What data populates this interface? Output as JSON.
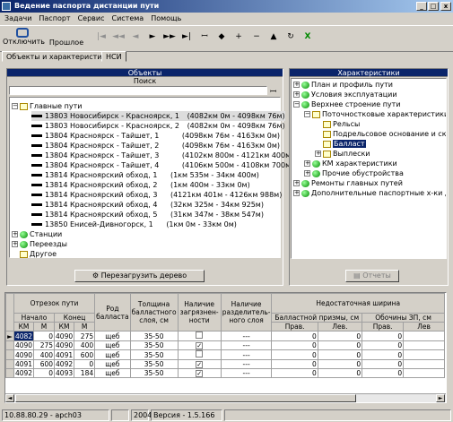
{
  "window": {
    "title": "Ведение паспорта дистанции пути"
  },
  "menu": [
    "Задачи",
    "Паспорт",
    "Сервис",
    "Система",
    "Помощь"
  ],
  "toolbar": {
    "disconnect": "Отключить",
    "past": "Прошлое"
  },
  "tabs": [
    "Объекты и характеристики",
    "НСИ"
  ],
  "objects": {
    "header": "Объекты",
    "search_label": "Поиск",
    "search_value": "",
    "tree": {
      "main": "Главные пути",
      "items": [
        {
          "name": "13803 Новосибирск - Красноярск, 1",
          "range": "(4082км 0м - 4098км 76м)"
        },
        {
          "name": "13803 Новосибирск - Красноярск, 2",
          "range": "(4082км 0м - 4098км 76м)"
        },
        {
          "name": "13804 Красноярск - Тайшет, 1",
          "range": "(4098км 76м - 4163км 0м)"
        },
        {
          "name": "13804 Красноярск - Тайшет, 2",
          "range": "(4098км 76м - 4163км 0м)"
        },
        {
          "name": "13804 Красноярск - Тайшет, 3",
          "range": "(4102км 800м - 4121км 400м)"
        },
        {
          "name": "13804 Красноярск - Тайшет, 4",
          "range": "(4106км 500м - 4108км 700м)"
        },
        {
          "name": "13814 Красноярский обход, 1",
          "range": "(1км 535м - 34км 400м)"
        },
        {
          "name": "13814 Красноярский обход, 2",
          "range": "(1км 400м - 33км 0м)"
        },
        {
          "name": "13814 Красноярский обход, 3",
          "range": "(4121км 401м - 4126км 988м)"
        },
        {
          "name": "13814 Красноярский обход, 4",
          "range": "(32км 325м - 34км 925м)"
        },
        {
          "name": "13814 Красноярский обход, 5",
          "range": "(31км 347м - 38км 547м)"
        },
        {
          "name": "13850 Енисей-Дивногорск, 1",
          "range": "(1км 0м - 33км 0м)"
        }
      ],
      "stations": "Станции",
      "crossings": "Переезды",
      "other": "Другое"
    },
    "reload_button": "Перезагрузить дерево"
  },
  "characteristics": {
    "header": "Характеристики",
    "items": {
      "plan": "План и профиль пути",
      "conditions": "Условия эксплуатации",
      "upper": "Верхнее строение пути",
      "point": "Поточностковые характеристики",
      "rails": "Рельсы",
      "subrail": "Подрельсовое основание и скре",
      "ballast": "Балласт",
      "recesses": "Выплески",
      "km": "КМ характеристики",
      "other_dev": "Прочие обустройства",
      "repairs": "Ремонты главных путей",
      "additional": "Дополнительные паспортные х-ки для А"
    },
    "reports_button": "Отчеты"
  },
  "grid": {
    "headers": {
      "segment": "Отрезок пути",
      "start": "Начало",
      "end": "Конец",
      "km": "КМ",
      "m": "М",
      "ballast_type": "Род балласта",
      "thickness": "Толщина балластного слоя, см",
      "contamination": "Наличие загрязнен- ности",
      "separating": "Наличие разделитель- ного слоя",
      "shortage": "Недостаточная ширина",
      "prism": "Балластной призмы, см",
      "zp": "Обочины ЗП, см",
      "right": "Прав.",
      "left": "Лев.",
      "prav2": "Прав.",
      "lev2": "Лев"
    },
    "rows": [
      {
        "k1": "4082",
        "m1": "0",
        "k2": "4090",
        "m2": "275",
        "kind": "щеб",
        "t": "35-50",
        "c": false,
        "s": "---",
        "a": "0",
        "b": "0",
        "c2": "0"
      },
      {
        "k1": "4090",
        "m1": "275",
        "k2": "4090",
        "m2": "400",
        "kind": "щеб",
        "t": "35-50",
        "c": true,
        "s": "---",
        "a": "0",
        "b": "0",
        "c2": "0"
      },
      {
        "k1": "4090",
        "m1": "400",
        "k2": "4091",
        "m2": "600",
        "kind": "щеб",
        "t": "35-50",
        "c": false,
        "s": "---",
        "a": "0",
        "b": "0",
        "c2": "0"
      },
      {
        "k1": "4091",
        "m1": "600",
        "k2": "4092",
        "m2": "0",
        "kind": "щеб",
        "t": "35-50",
        "c": true,
        "s": "---",
        "a": "0",
        "b": "0",
        "c2": "0"
      },
      {
        "k1": "4092",
        "m1": "0",
        "k2": "4093",
        "m2": "184",
        "kind": "щеб",
        "t": "35-50",
        "c": true,
        "s": "---",
        "a": "0",
        "b": "0",
        "c2": "0"
      }
    ]
  },
  "status": {
    "host": "10.88.80.29 - apch03",
    "year": "2004",
    "version": "Версия - 1.5.166"
  }
}
